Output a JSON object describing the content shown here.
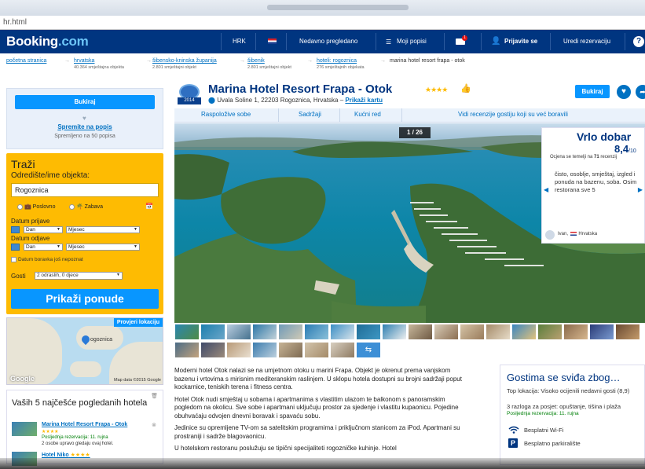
{
  "browser": {
    "url": "hr.html"
  },
  "header": {
    "logo_main": "Booking",
    "logo_suffix": ".com",
    "currency": "HRK",
    "recently_viewed": "Nedavno pregledano",
    "my_lists": "Moji popisi",
    "mail_badge": "1",
    "register": "Prijavite se",
    "manage_booking": "Uredi rezervaciju",
    "help": "?"
  },
  "breadcrumb": [
    {
      "label": "početna stranica",
      "sub": ""
    },
    {
      "label": "hrvatska",
      "sub": "40.364 smještajna objekta"
    },
    {
      "label": "šibensko-kninska županija",
      "sub": "2.801 smještajni objekt"
    },
    {
      "label": "šibenik",
      "sub": "2.801 smještajni objekt"
    },
    {
      "label": "hoteli: rogoznica",
      "sub": "276 smještajnih objekata"
    },
    {
      "label": "marina hotel resort frapa - otok",
      "sub": ""
    }
  ],
  "left": {
    "book_button": "Bukiraj",
    "save_link": "Spremite na popis",
    "saved_count": "Spremljeno na 50 popisa",
    "search": {
      "title": "Traži",
      "dest_label": "Odredište/ime objekta:",
      "dest_value": "Rogoznica",
      "purpose_business": "Poslovno",
      "purpose_leisure": "Zabava",
      "checkin_label": "Datum prijave",
      "checkout_label": "Datum odjave",
      "day_placeholder": "Dan",
      "month_placeholder": "Mjesec",
      "dates_unknown": "Datum boravka još nepoznat",
      "guests_label": "Gosti",
      "guests_value": "2 odraslih, 0 djece",
      "submit": "Prikaži ponude"
    },
    "map": {
      "show_location": "Provjeri lokaciju",
      "place": "ogoznica",
      "brand": "Google",
      "copyright": "Map data ©2015 Google"
    },
    "viewed": {
      "title": "Vaših 5 najčešće pogledanih hotela",
      "items": [
        {
          "name": "Marina Hotel Resort Frapa - Otok",
          "stars": "★★★★",
          "meta": "Posljednja rezervacija: 11. rujna",
          "meta2": "2 osobe upravo gledaju ovaj hotel."
        },
        {
          "name": "Hotel Niko",
          "stars": "★★★★"
        }
      ]
    }
  },
  "hotel": {
    "badge_year": "2014",
    "name": "Marina Hotel Resort Frapa - Otok",
    "stars": "★★★★",
    "address": "Uvala Soline 1, 22203 Rogoznica, Hrvatska –",
    "map_link": "Prikaži kartu",
    "book_button": "Bukiraj"
  },
  "tabs": [
    {
      "label": "Raspoložive sobe"
    },
    {
      "label": "Sadržaji"
    },
    {
      "label": "Kućni red"
    },
    {
      "label": "Vidi recenzije gostiju koji su već boravili"
    }
  ],
  "photo": {
    "counter": "1 / 26"
  },
  "review": {
    "title": "Vrlo dobar",
    "score": "8,4",
    "score_of": "/10",
    "based_prefix": "Ocjena se temelji na",
    "based_count": "71",
    "based_suffix": "recenzij",
    "text": "čisto, osoblje, smještaj, izgled i ponuda na bazenu, soba. Osim restorana sve 5",
    "user": "Ivan,",
    "country": "Hrvatska"
  },
  "description": [
    "Moderni hotel Otok nalazi se na umjetnom otoku u marini Frapa. Objekt je okrenut prema vanjskom bazenu i vrtovima s mirisnim mediteranskim raslinjem. U sklopu hotela dostupni su brojni sadržaji poput kockarnice, teniskih terena i fitness centra.",
    "Hotel Otok nudi smještaj u sobama i apartmanima s vlastitim ulazom te balkonom s panoramskim pogledom na okolicu. Sve sobe i apartmani uključuju prostor za sjedenje i vlastitu kupaonicu. Pojedine obuhvaćaju odvojen dnevni boravak i spavaću sobu.",
    "Jedinice su opremljene TV-om sa satelitskim programima i priključnom stanicom za iPod. Apartmani su prostraniji i sadrže blagovaonicu.",
    "U hotelskom restoranu poslužuju se tipični specijaliteti rogozničke kuhinje. Hotel"
  ],
  "likes": {
    "title": "Gostima se sviđa zbog…",
    "top_location": "Top lokacija: Visoko ocijenili nedavni gosti (8,9)",
    "reasons": "3 razloga za posjet: opuštanje, tišina i plaža",
    "last_booking": "Posljednja rezervacija: 11. rujna",
    "wifi": "Besplatni Wi-Fi",
    "parking": "Besplatno parkiralište",
    "parking_icon": "P"
  },
  "colors": {
    "brand": "#003580",
    "accent": "#0896ff",
    "search_bg": "#febb02"
  }
}
